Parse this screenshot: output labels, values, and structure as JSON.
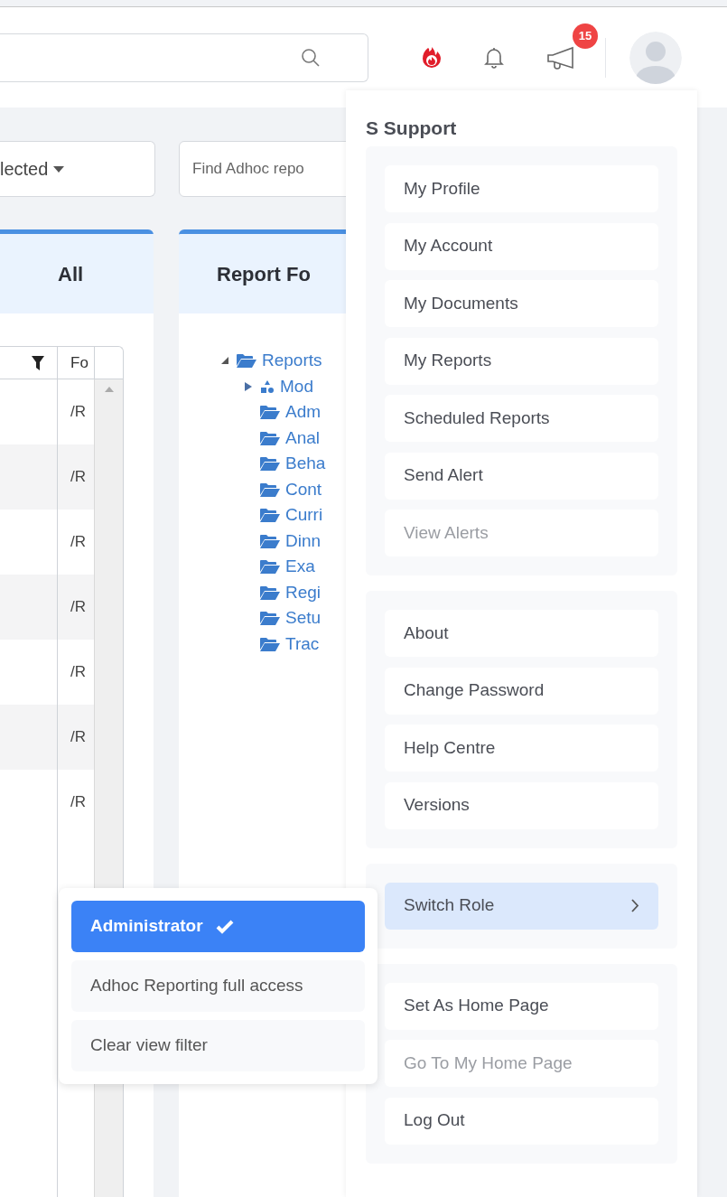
{
  "topbar": {
    "notification_badge": "15"
  },
  "filters": {
    "dropdown_value": "lected",
    "search_placeholder": "Find Adhoc repo"
  },
  "left_panel": {
    "title": "All",
    "table": {
      "columns": [
        "Fo"
      ],
      "rows": [
        "/R",
        "/R",
        "/R",
        "/R",
        "/R",
        "/R",
        "/R"
      ]
    }
  },
  "folders_panel": {
    "title": "Report Fo",
    "tree": [
      {
        "label": "Reports",
        "kind": "folder",
        "expanded": true,
        "children": [
          {
            "label": "Mod",
            "kind": "module",
            "expanded": false
          },
          {
            "label": "Adm",
            "kind": "folder"
          },
          {
            "label": "Anal",
            "kind": "folder"
          },
          {
            "label": "Beha",
            "kind": "folder"
          },
          {
            "label": "Cont",
            "kind": "folder"
          },
          {
            "label": "Curri",
            "kind": "folder"
          },
          {
            "label": "Dinn",
            "kind": "folder"
          },
          {
            "label": "Exa",
            "kind": "folder"
          },
          {
            "label": "Regi",
            "kind": "folder"
          },
          {
            "label": "Setu",
            "kind": "folder"
          },
          {
            "label": "Trac",
            "kind": "folder"
          }
        ]
      }
    ]
  },
  "user_menu": {
    "user_name": "S Support",
    "groups": [
      {
        "items": [
          {
            "label": "My Profile",
            "disabled": false
          },
          {
            "label": "My Account",
            "disabled": false
          },
          {
            "label": "My Documents",
            "disabled": false
          },
          {
            "label": "My Reports",
            "disabled": false
          },
          {
            "label": "Scheduled Reports",
            "disabled": false
          },
          {
            "label": "Send Alert",
            "disabled": false
          },
          {
            "label": "View Alerts",
            "disabled": true
          }
        ]
      },
      {
        "items": [
          {
            "label": "About",
            "disabled": false
          },
          {
            "label": "Change Password",
            "disabled": false
          },
          {
            "label": "Help Centre",
            "disabled": false
          },
          {
            "label": "Versions",
            "disabled": false
          }
        ]
      },
      {
        "items": [
          {
            "label": "Switch Role",
            "disabled": false,
            "submenu": true,
            "highlighted": true
          }
        ]
      },
      {
        "items": [
          {
            "label": "Set As Home Page",
            "disabled": false
          },
          {
            "label": "Go To My Home Page",
            "disabled": true
          },
          {
            "label": "Log Out",
            "disabled": false
          }
        ]
      }
    ]
  },
  "role_submenu": {
    "items": [
      {
        "label": "Administrator",
        "selected": true
      },
      {
        "label": "Adhoc Reporting full access",
        "selected": false
      },
      {
        "label": "Clear view filter",
        "selected": false
      }
    ]
  }
}
